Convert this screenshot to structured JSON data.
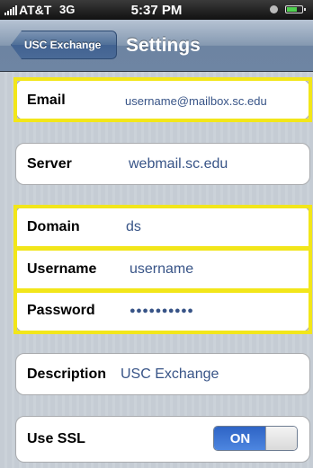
{
  "status_bar": {
    "carrier": "AT&T",
    "network": "3G",
    "time": "5:37 PM"
  },
  "nav": {
    "back_label": "USC Exchange",
    "title": "Settings"
  },
  "account": {
    "email_label": "Email",
    "email_value": "username@mailbox.sc.edu",
    "server_label": "Server",
    "server_value": "webmail.sc.edu",
    "domain_label": "Domain",
    "domain_value": "ds",
    "username_label": "Username",
    "username_value": "username",
    "password_label": "Password",
    "password_value": "●●●●●●●●●●",
    "description_label": "Description",
    "description_value": "USC Exchange",
    "ssl_label": "Use SSL",
    "ssl_state": "ON"
  },
  "colors": {
    "highlight": "#f2e61a",
    "value_text": "#385487",
    "toggle_on": "#2e64c5"
  }
}
